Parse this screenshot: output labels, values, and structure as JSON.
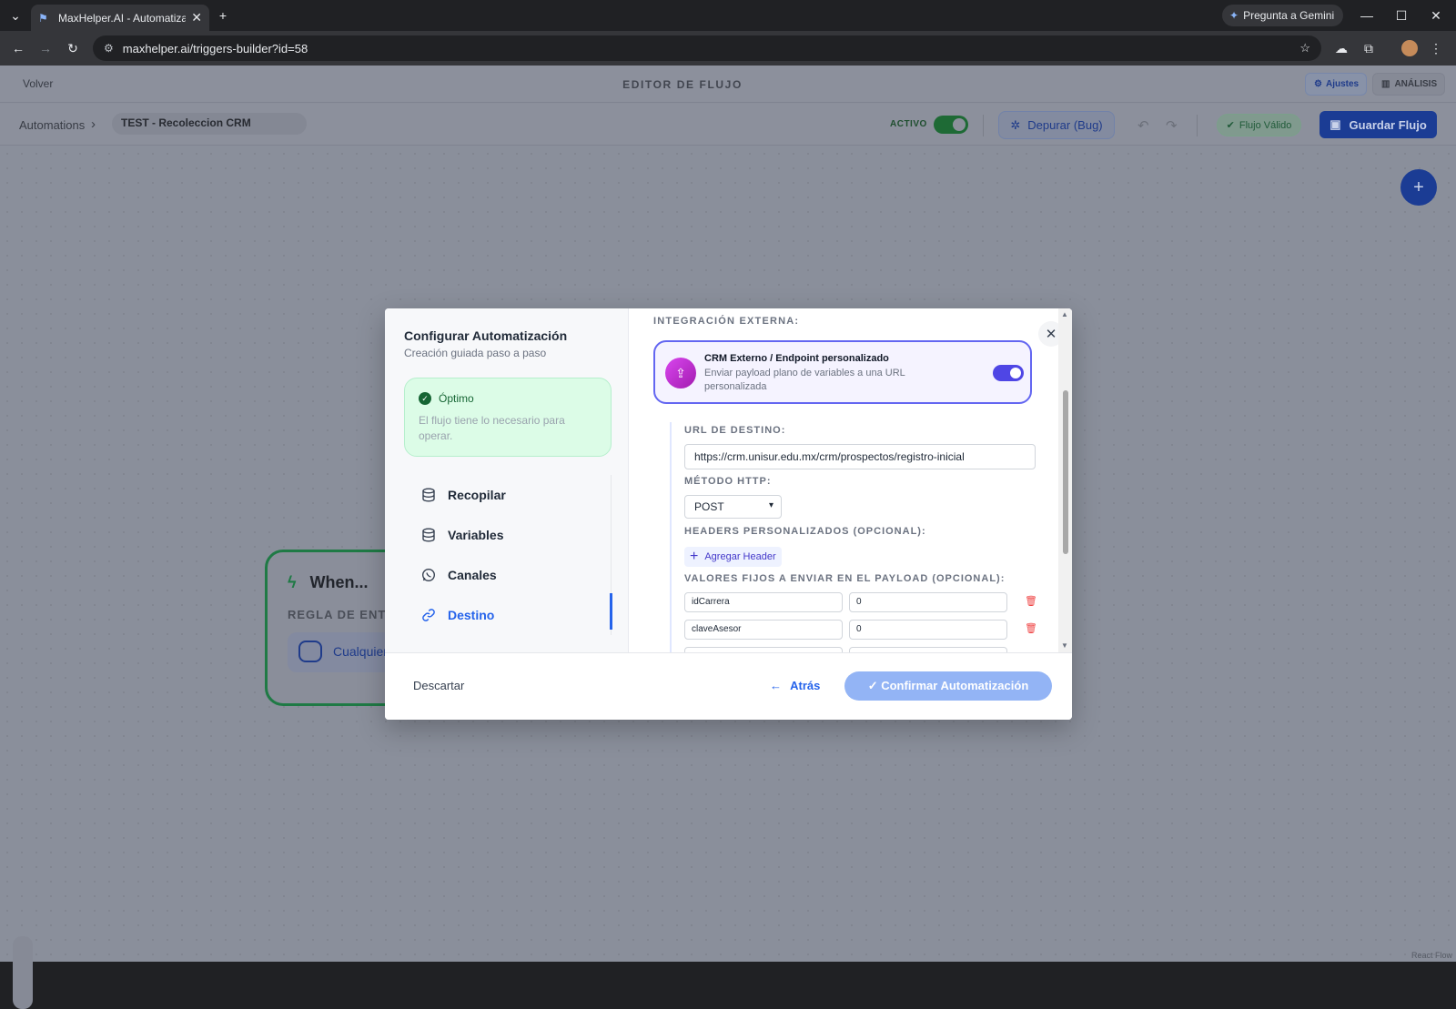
{
  "browser": {
    "tab_title": "MaxHelper.AI - Automatiza tu a",
    "url": "maxhelper.ai/triggers-builder?id=58",
    "gemini_label": "Pregunta a Gemini"
  },
  "topbar": {
    "back_label": "Volver",
    "title": "EDITOR DE FLUJO",
    "settings_label": "Ajustes",
    "analysis_label": "ANÁLISIS"
  },
  "secbar": {
    "crumb_root": "Automations",
    "flow_name": "TEST - Recoleccion CRM",
    "active_label": "ACTIVO",
    "debug_label": "Depurar (Bug)",
    "valid_label": "Flujo Válido",
    "save_label": "Guardar Flujo"
  },
  "node": {
    "title": "When...",
    "rule_label": "REGLA DE ENTR",
    "chip_label": "Cualquier"
  },
  "reactflow_label": "React Flow",
  "modal": {
    "title": "Configurar Automatización",
    "subtitle": "Creación guiada paso a paso",
    "status_title": "Óptimo",
    "status_text": "El flujo tiene lo necesario para operar.",
    "steps": [
      {
        "label": "Recopilar",
        "icon": "database-icon"
      },
      {
        "label": "Variables",
        "icon": "database-icon"
      },
      {
        "label": "Canales",
        "icon": "whatsapp-icon"
      },
      {
        "label": "Destino",
        "icon": "link-icon"
      }
    ],
    "section_title": "INTEGRACIÓN EXTERNA:",
    "crm_title": "CRM Externo / Endpoint personalizado",
    "crm_desc": "Enviar payload plano de variables a una URL personalizada",
    "url_label": "URL DE DESTINO:",
    "url_value": "https://crm.unisur.edu.mx/crm/prospectos/registro-inicial",
    "method_label": "MÉTODO HTTP:",
    "method_value": "POST",
    "headers_label": "HEADERS PERSONALIZADOS (OPCIONAL):",
    "add_header_label": "Agregar Header",
    "payload_label": "VALORES FIJOS A ENVIAR EN EL PAYLOAD (OPCIONAL):",
    "payload": [
      {
        "key": "idCarrera",
        "value": "0"
      },
      {
        "key": "claveAsesor",
        "value": "0"
      }
    ],
    "discard_label": "Descartar",
    "back_label": "Atrás",
    "confirm_label": "✓ Confirmar Automatización"
  },
  "colors": {
    "primary": "#2563eb",
    "accent_purple": "#6366f1",
    "success": "#166534",
    "danger": "#ef4444"
  }
}
